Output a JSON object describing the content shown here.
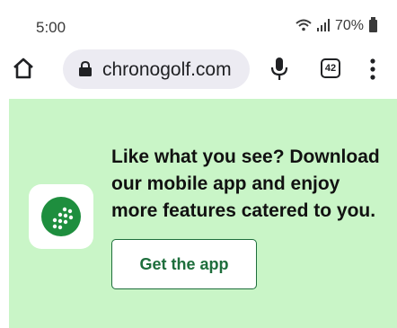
{
  "status_bar": {
    "time": "5:00",
    "battery_percent": "70%",
    "icons": [
      "wifi-icon",
      "signal-icon",
      "battery-icon"
    ]
  },
  "browser": {
    "url": "chronogolf.com",
    "tab_count": "42",
    "icons": [
      "home-icon",
      "lock-icon",
      "mic-icon",
      "tabs-icon",
      "menu-icon"
    ]
  },
  "banner": {
    "message": "Like what you see? Download our mobile app and enjoy more features catered to you.",
    "button_label": "Get the app",
    "app_icon": "chronogolf-logo-icon",
    "colors": {
      "banner_background": "#c9f5c7",
      "brand_green": "#1e8e3e",
      "button_text": "#1e6e3c"
    }
  }
}
